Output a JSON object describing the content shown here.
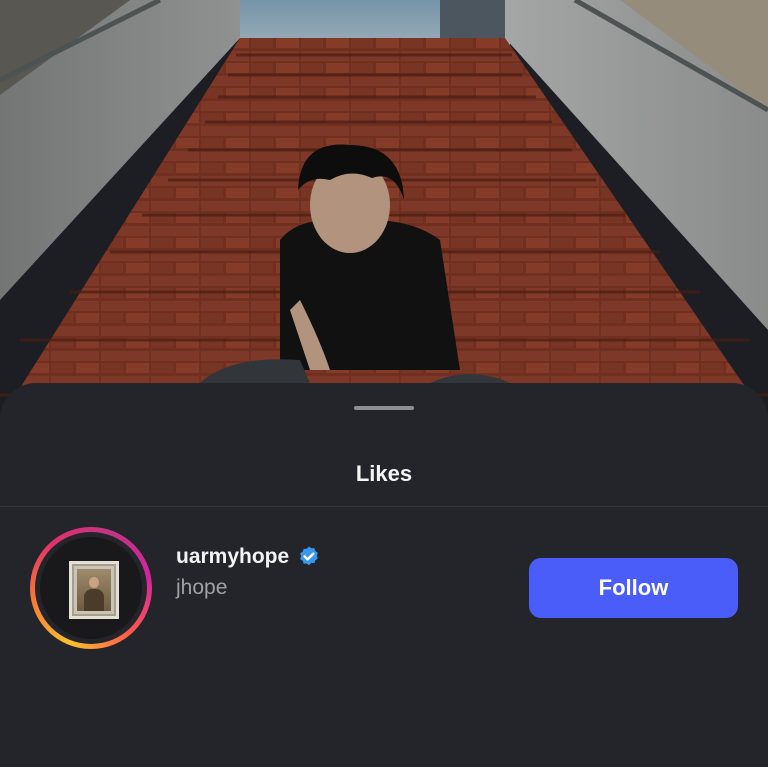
{
  "sheet": {
    "title": "Likes"
  },
  "likes": [
    {
      "username": "uarmyhope",
      "full_name": "jhope",
      "verified": true,
      "follow_label": "Follow"
    }
  ],
  "colors": {
    "sheet_bg": "#24252b",
    "follow_button": "#4a5df9",
    "verified_badge": "#3897f0"
  },
  "icons": {
    "verified": "verified-badge-icon",
    "avatar": "framed-portrait"
  }
}
